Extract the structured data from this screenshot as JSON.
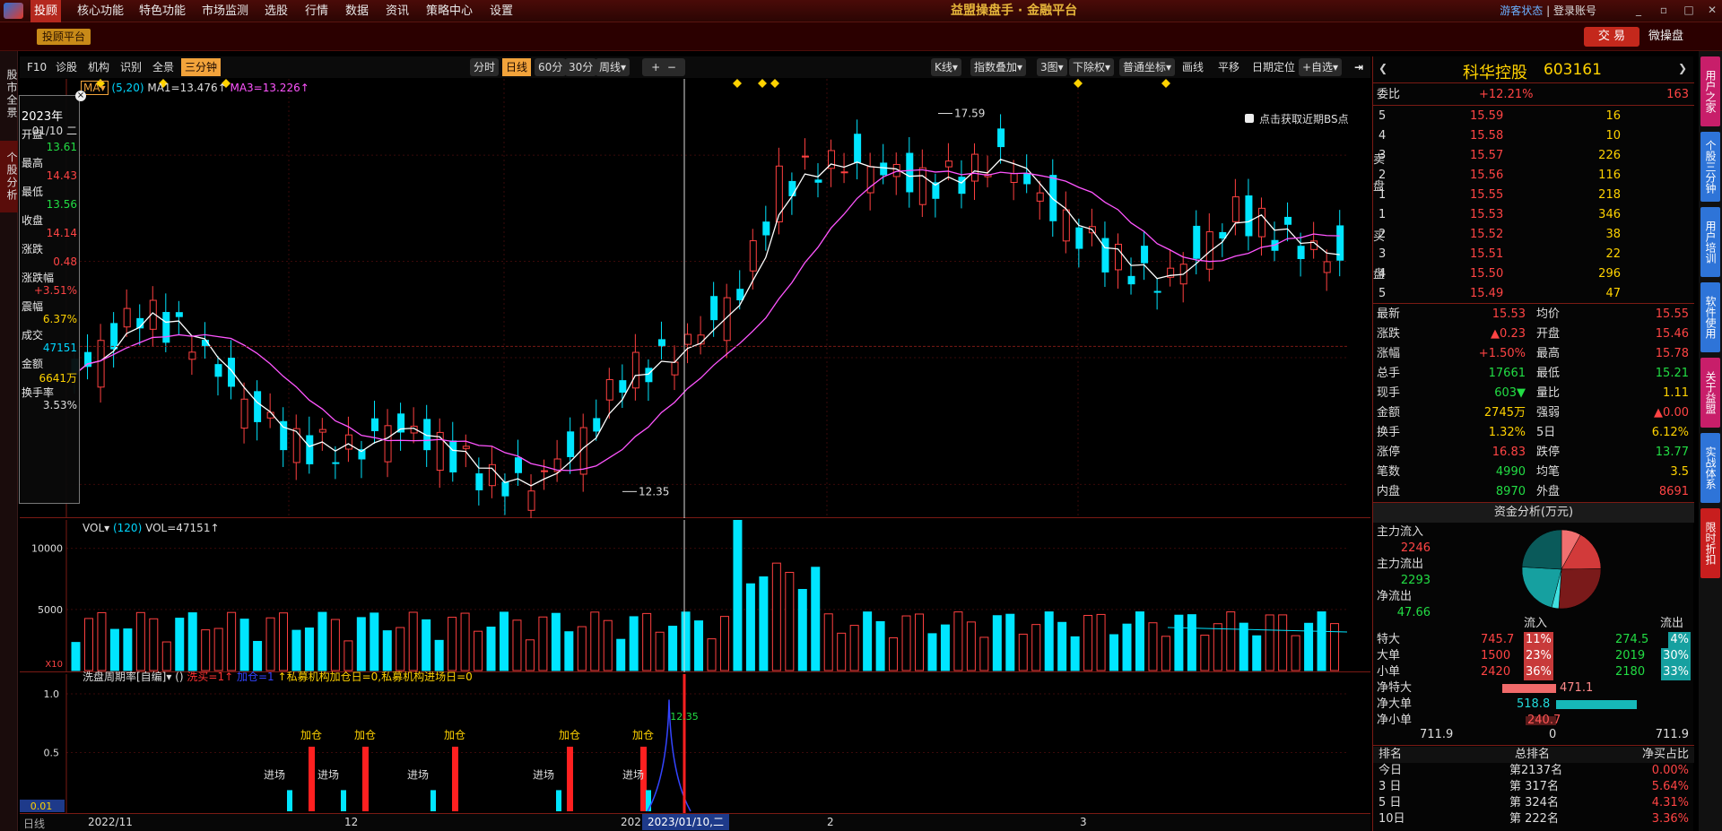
{
  "menubar": {
    "items": [
      "投顾",
      "核心功能",
      "特色功能",
      "市场监测",
      "选股",
      "行情",
      "数据",
      "资讯",
      "策略中心",
      "设置"
    ],
    "title": "益盟操盘手 · 金融平台",
    "guest": "游客状态",
    "login": "登录账号"
  },
  "toolbar": {
    "platform": "投顾平台",
    "trade": "交 易",
    "weipan": "微操盘"
  },
  "left_tabs": [
    "股市全景",
    "个股分析"
  ],
  "chart_toolbar": {
    "left": [
      "F10",
      "诊股",
      "机构",
      "识别",
      "全景",
      "三分钟"
    ],
    "periods": [
      "分时",
      "日线",
      "60分",
      "30分",
      "周线▾"
    ],
    "right": [
      "K线▾",
      "指数叠加▾",
      "3图▾",
      "下除权▾",
      "普通坐标▾",
      "画线",
      "平移",
      "日期定位",
      "+自选▾"
    ]
  },
  "legend": {
    "ma_label": "MA▾",
    "params": "(5,20)",
    "ma1": "MA1=13.476↑",
    "ma3": "MA3=13.226↑"
  },
  "bs_hint": "点击获取近期BS点",
  "info_panel": {
    "year": "2023年",
    "date": "01/10 二",
    "rows": [
      {
        "label": "开盘",
        "value": "13.61",
        "color": "#22dd44"
      },
      {
        "label": "最高",
        "value": "14.43",
        "color": "#ff4444"
      },
      {
        "label": "最低",
        "value": "13.56",
        "color": "#22dd44"
      },
      {
        "label": "收盘",
        "value": "14.14",
        "color": "#ff4444"
      },
      {
        "label": "涨跌",
        "value": "0.48",
        "color": "#ff4444"
      },
      {
        "label": "涨跌幅",
        "value": "+3.51%",
        "color": "#ff4444"
      },
      {
        "label": "震幅",
        "value": "6.37%",
        "color": "#ffd200"
      },
      {
        "label": "成交",
        "value": "47151",
        "color": "#00d7ff"
      },
      {
        "label": "金额",
        "value": "6641万",
        "color": "#ffd200"
      },
      {
        "label": "换手率",
        "value": "3.53%",
        "color": "#ddd"
      }
    ]
  },
  "price_marks": {
    "high": "17.59",
    "low": "12.35"
  },
  "vol_panel": {
    "title": "VOL▾",
    "param": "(120)",
    "value": "VOL=47151↑",
    "y_labels": [
      "10000",
      "5000",
      "X10"
    ]
  },
  "ind_panel": {
    "title": "洗盘周期率[自编]▾",
    "params": "()",
    "a": "洗买=1↑",
    "b": "加仓=1",
    "c": "↑私募机构加仓日=0,私募机构进场日=0",
    "y_labels": [
      "1.0",
      "0.5",
      "0.01"
    ],
    "labels_join": "加仓",
    "labels_enter": "进场",
    "peak": "12.35"
  },
  "x_axis": {
    "labels": [
      "2022/11",
      "12",
      "202",
      "2023/01/10,二",
      "2",
      "3"
    ],
    "period": "日线"
  },
  "chart_data": {
    "type": "candlestick",
    "title": "科华控股 603161",
    "high": 17.59,
    "low": 12.35,
    "ma_params": [
      5,
      20
    ]
  },
  "quote": {
    "name": "科华控股",
    "code": "603161",
    "weibi": {
      "label": "委比",
      "value": "+12.21%",
      "diff": "163"
    },
    "sells": [
      {
        "n": "5",
        "price": "15.59",
        "vol": "16"
      },
      {
        "n": "4",
        "price": "15.58",
        "vol": "10"
      },
      {
        "n": "3",
        "price": "15.57",
        "vol": "226"
      },
      {
        "n": "2",
        "price": "15.56",
        "vol": "116"
      },
      {
        "n": "1",
        "price": "15.55",
        "vol": "218"
      }
    ],
    "buys": [
      {
        "n": "1",
        "price": "15.53",
        "vol": "346"
      },
      {
        "n": "2",
        "price": "15.52",
        "vol": "38"
      },
      {
        "n": "3",
        "price": "15.51",
        "vol": "22"
      },
      {
        "n": "4",
        "price": "15.50",
        "vol": "296"
      },
      {
        "n": "5",
        "price": "15.49",
        "vol": "47"
      }
    ],
    "side_sell": [
      "卖",
      "盘"
    ],
    "side_buy": [
      "买",
      "盘"
    ],
    "stats": [
      [
        "最新",
        "15.53",
        "均价",
        "15.55"
      ],
      [
        "涨跌",
        "▲0.23",
        "开盘",
        "15.46"
      ],
      [
        "涨幅",
        "+1.50%",
        "最高",
        "15.78"
      ],
      [
        "总手",
        "17661",
        "最低",
        "15.21"
      ],
      [
        "现手",
        "603▼",
        "量比",
        "1.11"
      ],
      [
        "金额",
        "2745万",
        "强弱",
        "▲0.00"
      ],
      [
        "换手",
        "1.32%",
        "5日",
        "6.12%"
      ],
      [
        "涨停",
        "16.83",
        "跌停",
        "13.77"
      ],
      [
        "笔数",
        "4990",
        "均笔",
        "3.5"
      ],
      [
        "内盘",
        "8970",
        "外盘",
        "8691"
      ]
    ]
  },
  "fund": {
    "title": "资金分析(万元)",
    "main_in_label": "主力流入",
    "main_in": "2246",
    "main_out_label": "主力流出",
    "main_out": "2293",
    "net_out_label": "净流出",
    "net_out": "47.66",
    "col_in": "流入",
    "col_out": "流出",
    "rows": [
      {
        "label": "特大",
        "in": "745.7",
        "inp": "11%",
        "out": "274.5",
        "outp": "4%"
      },
      {
        "label": "大单",
        "in": "1500",
        "inp": "23%",
        "out": "2019",
        "outp": "30%"
      },
      {
        "label": "小单",
        "in": "2420",
        "inp": "36%",
        "out": "2180",
        "outp": "33%"
      }
    ],
    "net": [
      {
        "label": "净特大",
        "value": "471.1"
      },
      {
        "label": "净大单",
        "value": "518.8"
      },
      {
        "label": "净小单",
        "value": "240.7"
      }
    ],
    "axis": [
      "711.9",
      "0",
      "711.9"
    ]
  },
  "rank": {
    "headers": [
      "排名",
      "总排名",
      "净买占比"
    ],
    "rows": [
      [
        "今日",
        "第2137名",
        "0.00%"
      ],
      [
        "3 日",
        "第 317名",
        "5.64%"
      ],
      [
        "5 日",
        "第 324名",
        "4.31%"
      ],
      [
        "10日",
        "第 222名",
        "3.36%"
      ]
    ]
  },
  "right_sidebar": [
    "用户之家",
    "个股三分钟",
    "用户培训",
    "软件使用",
    "关于益盟",
    "实战体系",
    "限时折扣"
  ]
}
